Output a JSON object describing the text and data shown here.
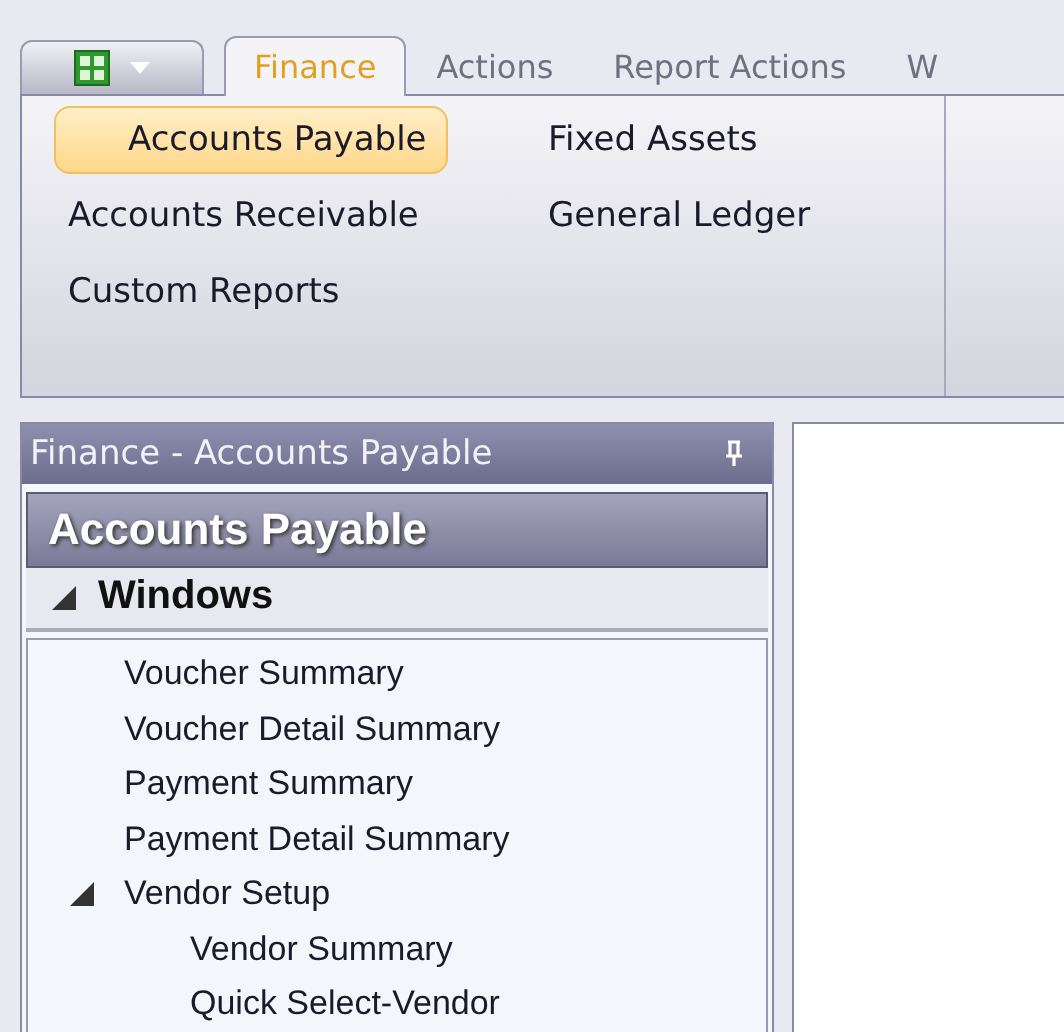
{
  "ribbon": {
    "tabs": [
      {
        "label": "Finance",
        "selected": true
      },
      {
        "label": "Actions",
        "selected": false
      },
      {
        "label": "Report Actions",
        "selected": false
      },
      {
        "label": "W",
        "selected": false
      }
    ],
    "items": [
      {
        "label": "Accounts Payable",
        "selected": true
      },
      {
        "label": "Accounts Receivable",
        "selected": false
      },
      {
        "label": "Custom Reports",
        "selected": false
      },
      {
        "label": "Fixed Assets",
        "selected": false
      },
      {
        "label": "General Ledger",
        "selected": false
      }
    ]
  },
  "sidebar": {
    "caption": "Finance - Accounts Payable",
    "title": "Accounts Payable",
    "section": {
      "label": "Windows",
      "expanded": true,
      "children": [
        {
          "label": "Voucher Summary"
        },
        {
          "label": "Voucher Detail Summary"
        },
        {
          "label": "Payment Summary"
        },
        {
          "label": "Payment Detail Summary"
        },
        {
          "label": "Vendor Setup",
          "expanded": true,
          "children": [
            {
              "label": "Vendor Summary"
            },
            {
              "label": "Quick Select-Vendor"
            }
          ]
        }
      ]
    }
  }
}
